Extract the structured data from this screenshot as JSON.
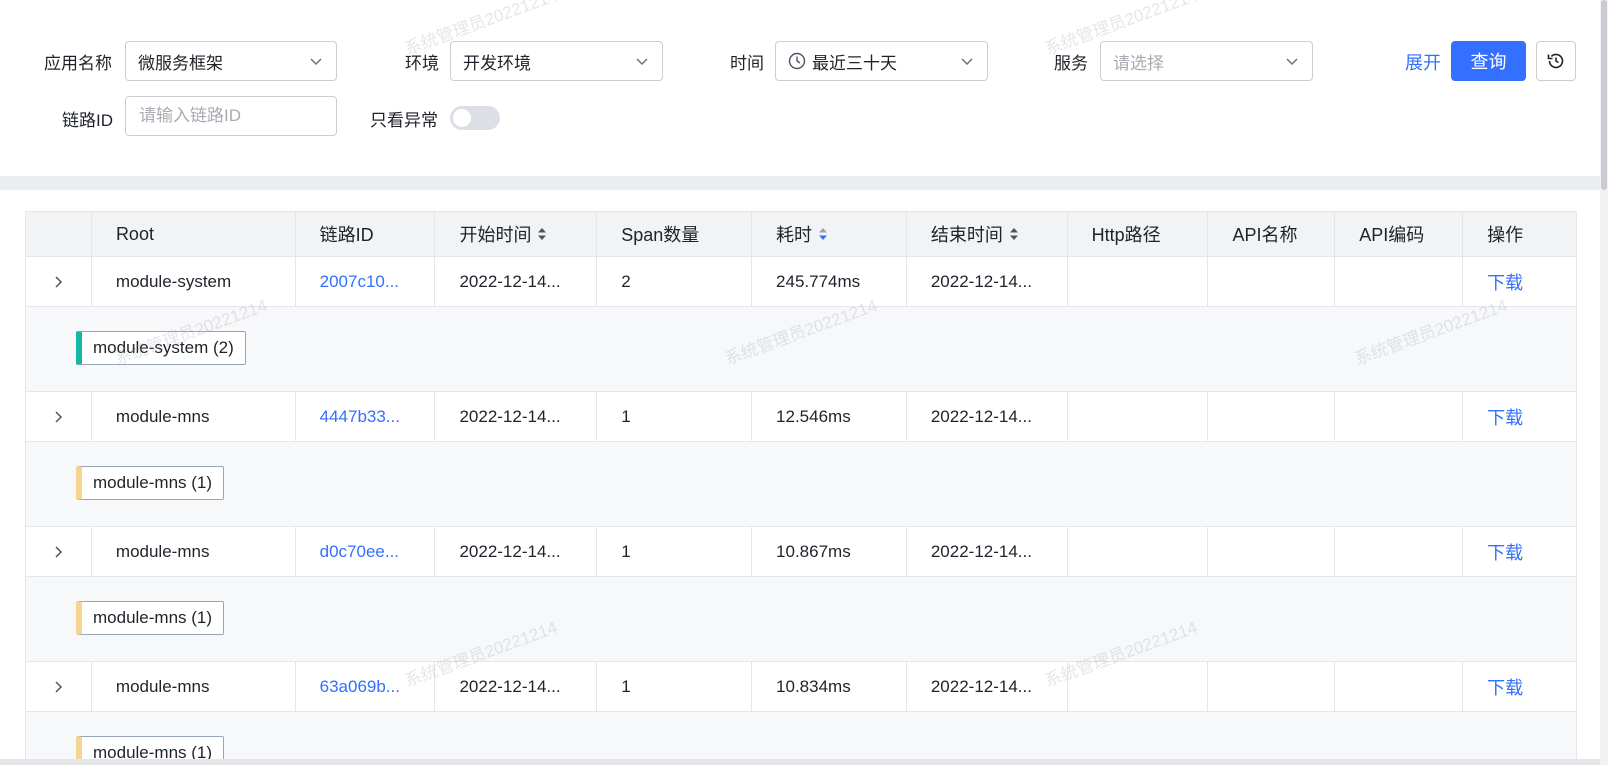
{
  "filters": {
    "app_name_label": "应用名称",
    "app_name_value": "微服务框架",
    "env_label": "环境",
    "env_value": "开发环境",
    "time_label": "时间",
    "time_value": "最近三十天",
    "service_label": "服务",
    "service_placeholder": "请选择",
    "trace_id_label": "链路ID",
    "trace_id_placeholder": "请输入链路ID",
    "errors_only_label": "只看异常",
    "errors_only_on": false,
    "expand_label": "展开",
    "query_label": "查询"
  },
  "watermark": "系统管理员20221214",
  "table": {
    "columns": [
      "",
      "Root",
      "链路ID",
      "开始时间",
      "Span数量",
      "耗时",
      "结束时间",
      "Http路径",
      "API名称",
      "API编码",
      "操作"
    ],
    "rows": [
      {
        "root": "module-system",
        "trace_id": "2007c10...",
        "start": "2022-12-14...",
        "spans": "2",
        "duration": "245.774ms",
        "end": "2022-12-14...",
        "http": "",
        "api_name": "",
        "api_code": "",
        "action": "下载",
        "tag": "module-system (2)",
        "tag_color": "#14b8a6"
      },
      {
        "root": "module-mns",
        "trace_id": "4447b33...",
        "start": "2022-12-14...",
        "spans": "1",
        "duration": "12.546ms",
        "end": "2022-12-14...",
        "http": "",
        "api_name": "",
        "api_code": "",
        "action": "下载",
        "tag": "module-mns (1)",
        "tag_color": "#f5d58f"
      },
      {
        "root": "module-mns",
        "trace_id": "d0c70ee...",
        "start": "2022-12-14...",
        "spans": "1",
        "duration": "10.867ms",
        "end": "2022-12-14...",
        "http": "",
        "api_name": "",
        "api_code": "",
        "action": "下载",
        "tag": "module-mns (1)",
        "tag_color": "#f5d58f"
      },
      {
        "root": "module-mns",
        "trace_id": "63a069b...",
        "start": "2022-12-14...",
        "spans": "1",
        "duration": "10.834ms",
        "end": "2022-12-14...",
        "http": "",
        "api_name": "",
        "api_code": "",
        "action": "下载",
        "tag": "module-mns (1)",
        "tag_color": "#f5d58f"
      }
    ]
  },
  "colors": {
    "accent": "#3370ff",
    "header_bg": "#f2f3f5",
    "detail_bg": "#f7f8fa"
  }
}
